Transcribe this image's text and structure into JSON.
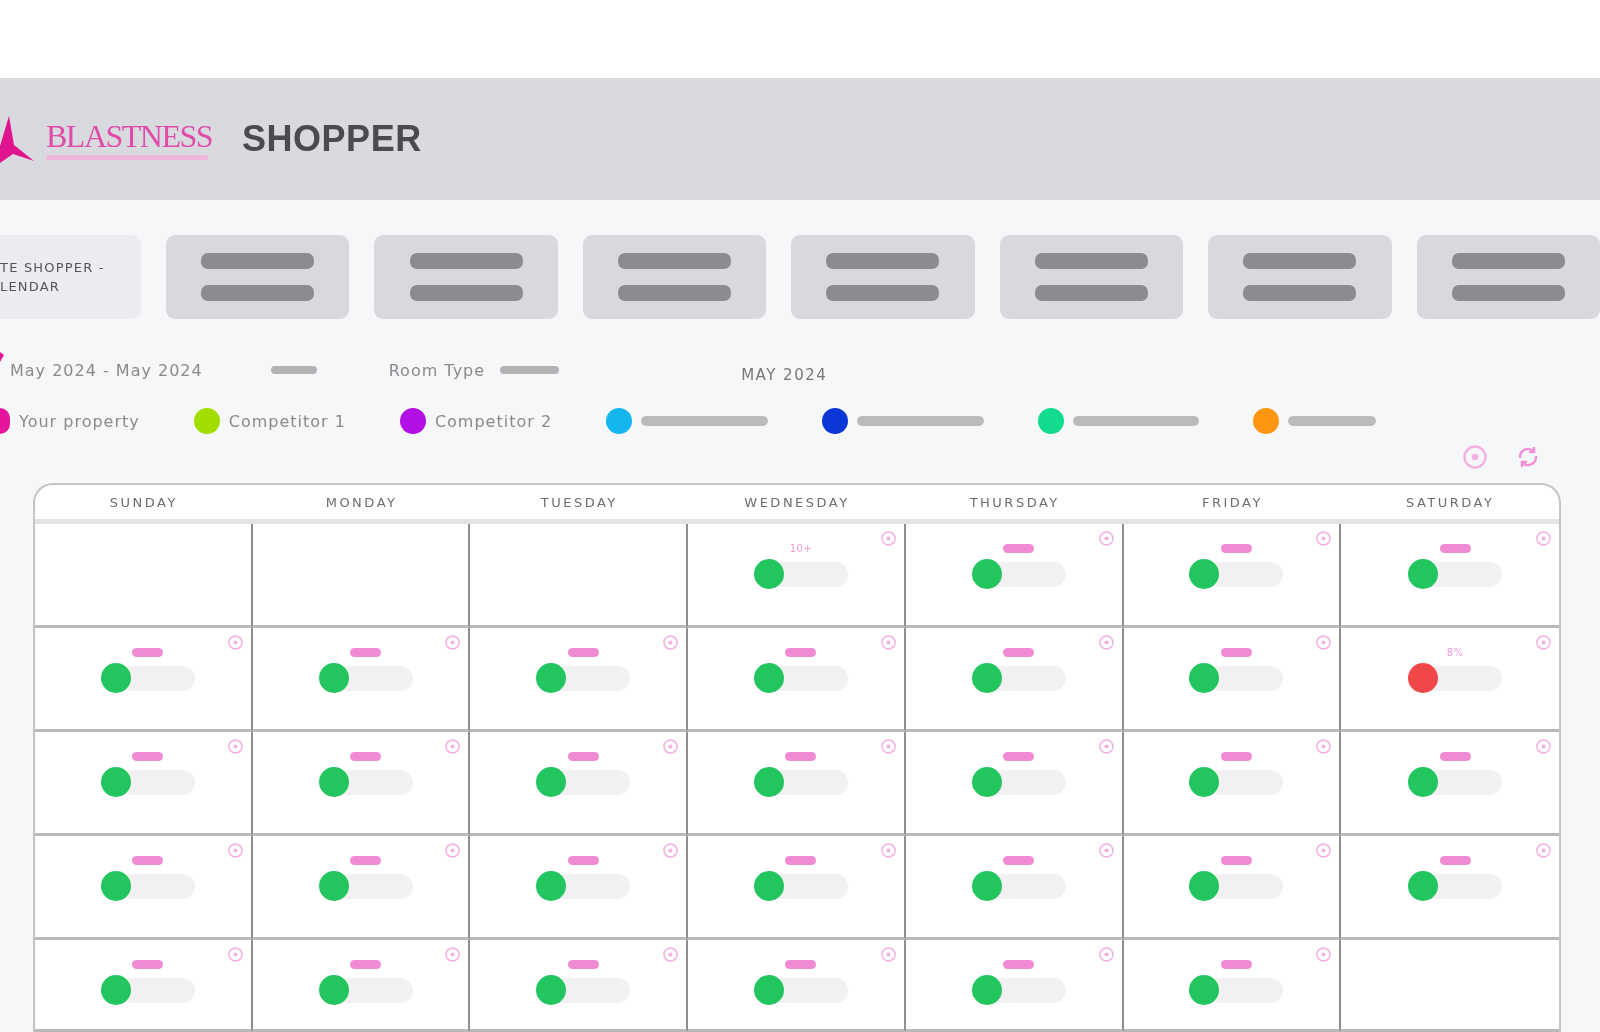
{
  "header": {
    "brand": "BLASTNESS",
    "title": "SHOPPER"
  },
  "tabs": [
    {
      "kind": "text",
      "lines": [
        "TE SHOPPER -",
        "LENDAR"
      ],
      "selected": true
    },
    {
      "kind": "placeholder",
      "selected": false
    },
    {
      "kind": "placeholder",
      "selected": false
    },
    {
      "kind": "placeholder",
      "selected": false
    },
    {
      "kind": "placeholder",
      "selected": false
    },
    {
      "kind": "placeholder",
      "selected": false
    },
    {
      "kind": "placeholder",
      "selected": false
    },
    {
      "kind": "placeholder",
      "selected": false
    }
  ],
  "filters": {
    "date_range": "May 2024 - May 2024",
    "room_type_label": "Room Type",
    "month": "MAY 2024"
  },
  "legend": [
    {
      "kind": "label",
      "label": "Your property",
      "color": "#e5169b"
    },
    {
      "kind": "label",
      "label": "Competitor 1",
      "color": "#a3dd00"
    },
    {
      "kind": "label",
      "label": "Competitor 2",
      "color": "#b20fe3"
    },
    {
      "kind": "placeholder",
      "color": "#14b6ef"
    },
    {
      "kind": "placeholder",
      "color": "#0b37d9"
    },
    {
      "kind": "placeholder",
      "color": "#13db8d"
    },
    {
      "kind": "placeholder",
      "color": "#ff9612"
    }
  ],
  "calendar": {
    "weekdays": [
      "SUNDAY",
      "MONDAY",
      "TUESDAY",
      "WEDNESDAY",
      "THURSDAY",
      "FRIDAY",
      "SATURDAY"
    ],
    "weeks": [
      {
        "days": [
          {
            "kind": "empty"
          },
          {
            "kind": "empty"
          },
          {
            "kind": "empty"
          },
          {
            "kind": "rate",
            "tag": "10+",
            "color": "#22c55e"
          },
          {
            "kind": "rate",
            "color": "#22c55e"
          },
          {
            "kind": "rate",
            "color": "#22c55e"
          },
          {
            "kind": "rate",
            "color": "#22c55e"
          }
        ]
      },
      {
        "days": [
          {
            "kind": "rate",
            "color": "#22c55e"
          },
          {
            "kind": "rate",
            "color": "#22c55e"
          },
          {
            "kind": "rate",
            "color": "#22c55e"
          },
          {
            "kind": "rate",
            "color": "#22c55e"
          },
          {
            "kind": "rate",
            "color": "#22c55e"
          },
          {
            "kind": "rate",
            "color": "#22c55e"
          },
          {
            "kind": "rate",
            "tag": "8%",
            "color": "#f04848"
          }
        ]
      },
      {
        "days": [
          {
            "kind": "rate",
            "color": "#22c55e"
          },
          {
            "kind": "rate",
            "color": "#22c55e"
          },
          {
            "kind": "rate",
            "color": "#22c55e"
          },
          {
            "kind": "rate",
            "color": "#22c55e"
          },
          {
            "kind": "rate",
            "color": "#22c55e"
          },
          {
            "kind": "rate",
            "color": "#22c55e"
          },
          {
            "kind": "rate",
            "color": "#22c55e"
          }
        ]
      },
      {
        "days": [
          {
            "kind": "rate",
            "color": "#22c55e"
          },
          {
            "kind": "rate",
            "color": "#22c55e"
          },
          {
            "kind": "rate",
            "color": "#22c55e"
          },
          {
            "kind": "rate",
            "color": "#22c55e"
          },
          {
            "kind": "rate",
            "color": "#22c55e"
          },
          {
            "kind": "rate",
            "color": "#22c55e"
          },
          {
            "kind": "rate",
            "color": "#22c55e"
          }
        ]
      },
      {
        "days": [
          {
            "kind": "rate",
            "color": "#22c55e"
          },
          {
            "kind": "rate",
            "color": "#22c55e"
          },
          {
            "kind": "rate",
            "color": "#22c55e"
          },
          {
            "kind": "rate",
            "color": "#22c55e"
          },
          {
            "kind": "rate",
            "color": "#22c55e"
          },
          {
            "kind": "rate",
            "color": "#22c55e"
          },
          {
            "kind": "empty"
          }
        ]
      }
    ]
  }
}
